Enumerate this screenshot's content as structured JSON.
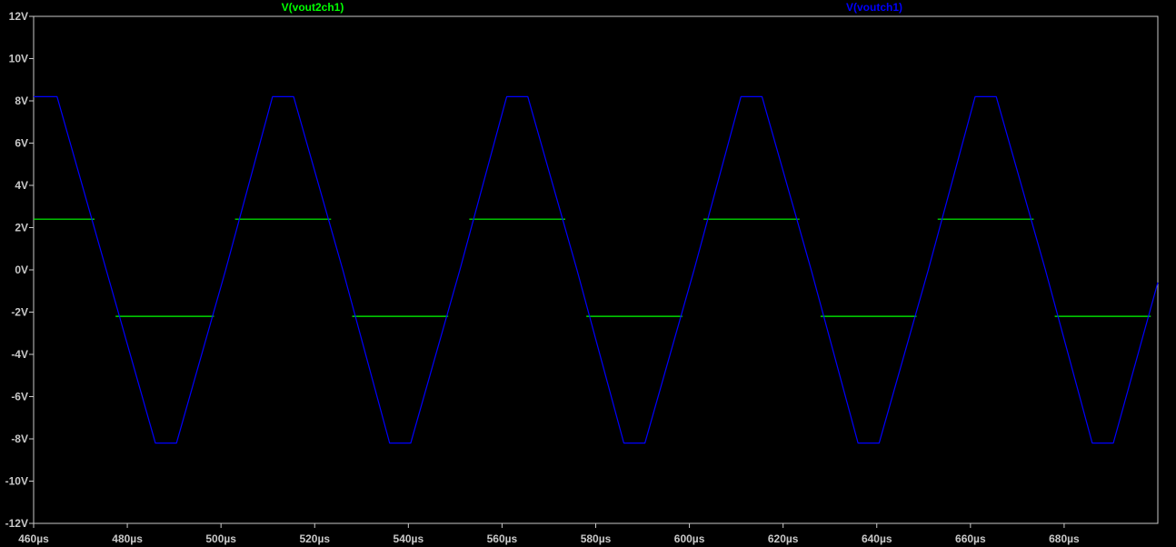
{
  "chart_data": {
    "type": "line",
    "title": "",
    "xlabel": "",
    "ylabel": "",
    "xlim": [
      460,
      700
    ],
    "ylim": [
      -12,
      12
    ],
    "x_ticks": [
      {
        "value": 460,
        "label": "460µs"
      },
      {
        "value": 480,
        "label": "480µs"
      },
      {
        "value": 500,
        "label": "500µs"
      },
      {
        "value": 520,
        "label": "520µs"
      },
      {
        "value": 540,
        "label": "540µs"
      },
      {
        "value": 560,
        "label": "560µs"
      },
      {
        "value": 580,
        "label": "580µs"
      },
      {
        "value": 600,
        "label": "600µs"
      },
      {
        "value": 620,
        "label": "620µs"
      },
      {
        "value": 640,
        "label": "640µs"
      },
      {
        "value": 660,
        "label": "660µs"
      },
      {
        "value": 680,
        "label": "680µs"
      }
    ],
    "y_ticks": [
      {
        "value": 12,
        "label": "12V"
      },
      {
        "value": 10,
        "label": "10V"
      },
      {
        "value": 8,
        "label": "8V"
      },
      {
        "value": 6,
        "label": "6V"
      },
      {
        "value": 4,
        "label": "4V"
      },
      {
        "value": 2,
        "label": "2V"
      },
      {
        "value": 0,
        "label": "0V"
      },
      {
        "value": -2,
        "label": "-2V"
      },
      {
        "value": -4,
        "label": "-4V"
      },
      {
        "value": -6,
        "label": "-6V"
      },
      {
        "value": -8,
        "label": "-8V"
      },
      {
        "value": -10,
        "label": "-10V"
      },
      {
        "value": -12,
        "label": "-12V"
      }
    ],
    "grid": false,
    "colors": {
      "background": "#000000",
      "axis": "#c8c8c8",
      "vout2ch1": "#00ff00",
      "voutch1": "#0000ff"
    },
    "series": [
      {
        "name": "V(vout2ch1)",
        "color": "#00ff00",
        "x": [
          460,
          473,
          473,
          477.5,
          477.5,
          498.5,
          498.5,
          503,
          503,
          523.5,
          523.5,
          528,
          528,
          548.5,
          548.5,
          553,
          553,
          573.5,
          573.5,
          578,
          578,
          598.5,
          598.5,
          603,
          603,
          623.5,
          623.5,
          628,
          628,
          648.5,
          648.5,
          653,
          653,
          673.5,
          673.5,
          678,
          678,
          698.5,
          698.5
        ],
        "values": [
          2.4,
          2.4,
          null,
          null,
          -2.2,
          -2.2,
          null,
          null,
          2.4,
          2.4,
          null,
          null,
          -2.2,
          -2.2,
          null,
          null,
          2.4,
          2.4,
          null,
          null,
          -2.2,
          -2.2,
          null,
          null,
          2.4,
          2.4,
          null,
          null,
          -2.2,
          -2.2,
          null,
          null,
          2.4,
          2.4,
          null,
          null,
          -2.2,
          -2.2,
          null
        ]
      },
      {
        "name": "V(voutch1)",
        "color": "#0000ff",
        "x": [
          460,
          465,
          475.5,
          486,
          490.5,
          501,
          511,
          515.5,
          526,
          536,
          540.5,
          551,
          561,
          565.5,
          576,
          586,
          590.5,
          601,
          611,
          615.5,
          626,
          636,
          640.5,
          651,
          661,
          665.5,
          676,
          686,
          690.5,
          700
        ],
        "values": [
          8.2,
          8.2,
          0,
          -8.2,
          -8.2,
          0,
          8.2,
          8.2,
          0,
          -8.2,
          -8.2,
          0,
          8.2,
          8.2,
          0,
          -8.2,
          -8.2,
          0,
          8.2,
          8.2,
          0,
          -8.2,
          -8.2,
          0,
          8.2,
          8.2,
          0,
          -8.2,
          -8.2,
          -0.6
        ]
      }
    ],
    "legend": [
      {
        "label": "V(vout2ch1)",
        "color": "#00ff00",
        "position": "top-center-left"
      },
      {
        "label": "V(voutch1)",
        "color": "#0000ff",
        "position": "top-center-right"
      }
    ]
  }
}
